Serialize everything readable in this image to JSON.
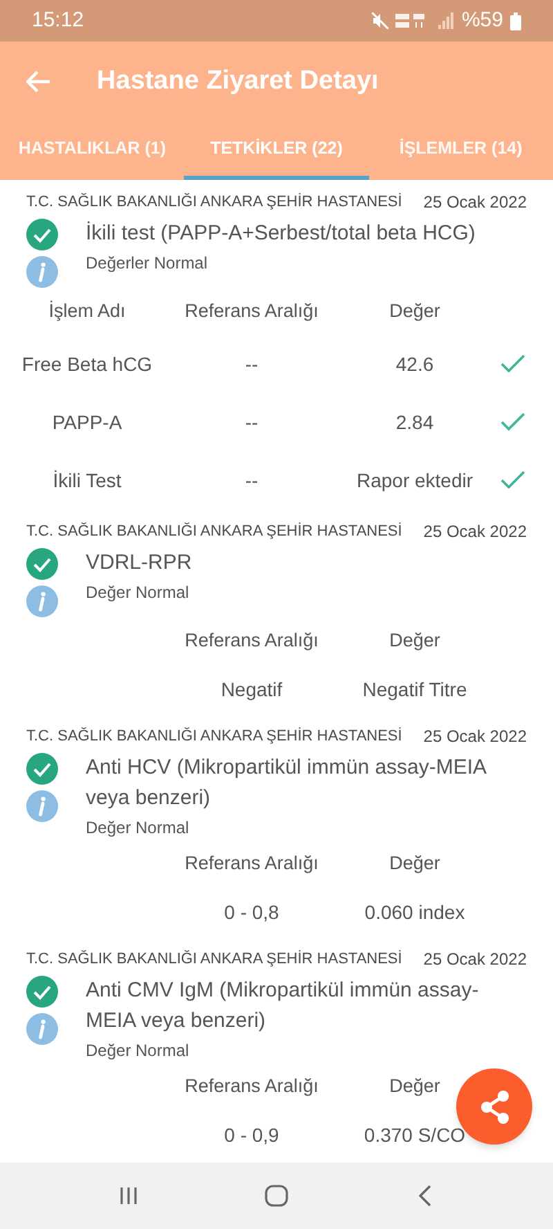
{
  "status_bar": {
    "time": "15:12",
    "battery": "%59"
  },
  "app_bar": {
    "title": "Hastane Ziyaret Detayı"
  },
  "tabs": [
    {
      "label": "HASTALIKLAR (1)",
      "selected": false
    },
    {
      "label": "TETKİKLER (22)",
      "selected": true
    },
    {
      "label": "İŞLEMLER (14)",
      "selected": false
    }
  ],
  "results": [
    {
      "hospital": "T.C. SAĞLIK BAKANLIĞI ANKARA ŞEHİR HASTANESİ",
      "date": "25 Ocak 2022",
      "title": "İkili test (PAPP-A+Serbest/total beta HCG)",
      "status": "Değerler Normal",
      "columns": {
        "name": "İşlem Adı",
        "reference": "Referans Aralığı",
        "value": "Değer"
      },
      "rows": [
        {
          "name": "Free Beta hCG",
          "reference": "--",
          "value": "42.6",
          "checked": true
        },
        {
          "name": "PAPP-A",
          "reference": "--",
          "value": "2.84",
          "checked": true
        },
        {
          "name": "İkili Test",
          "reference": "--",
          "value": "Rapor ektedir",
          "checked": true
        }
      ]
    },
    {
      "hospital": "T.C. SAĞLIK BAKANLIĞI ANKARA ŞEHİR HASTANESİ",
      "date": "25 Ocak 2022",
      "title": "VDRL-RPR",
      "status": "Değer Normal",
      "columns": {
        "reference": "Referans Aralığı",
        "value": "Değer"
      },
      "rows": [
        {
          "reference": "Negatif",
          "value": "Negatif Titre"
        }
      ]
    },
    {
      "hospital": "T.C. SAĞLIK BAKANLIĞI ANKARA ŞEHİR HASTANESİ",
      "date": "25 Ocak 2022",
      "title": "Anti HCV (Mikropartikül immün assay-MEIA veya benzeri)",
      "status": "Değer Normal",
      "columns": {
        "reference": "Referans Aralığı",
        "value": "Değer"
      },
      "rows": [
        {
          "reference": "0 - 0,8",
          "value": "0.060 index"
        }
      ]
    },
    {
      "hospital": "T.C. SAĞLIK BAKANLIĞI ANKARA ŞEHİR HASTANESİ",
      "date": "25 Ocak 2022",
      "title": "Anti CMV IgM (Mikropartikül immün assay-MEIA veya benzeri)",
      "status": "Değer Normal",
      "columns": {
        "reference": "Referans Aralığı",
        "value": "Değer"
      },
      "rows": [
        {
          "reference": "0 - 0,9",
          "value": "0.370 S/CO"
        }
      ]
    }
  ]
}
